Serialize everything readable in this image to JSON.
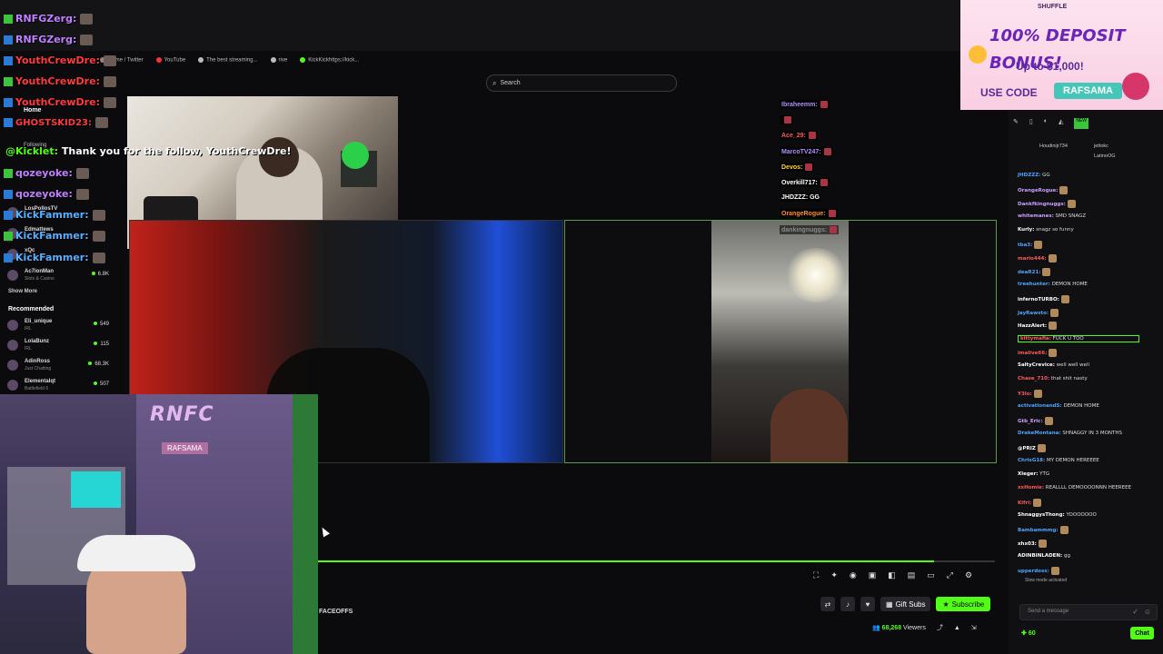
{
  "bookmarks": [
    "Home / Twitter",
    "YouTube",
    "The best streaming...",
    "rive",
    "KickKickhttps://kick..."
  ],
  "search": {
    "placeholder": "Search"
  },
  "nav": {
    "home": "Home",
    "following": "Following",
    "show_more": "Show More",
    "recommended": "Recommended"
  },
  "overlay_chat": [
    {
      "name": "RNFGZerg:",
      "color": "#c080ff"
    },
    {
      "name": "RNFGZerg:",
      "color": "#c080ff"
    },
    {
      "name": "YouthCrewDre:",
      "color": "#ff3b3b"
    },
    {
      "name": "YouthCrewDre:",
      "color": "#ff3b3b"
    },
    {
      "name": "YouthCrewDre:",
      "color": "#ff3b3b"
    },
    {
      "name": "GHOSTSKID23:",
      "color": "#ff3b3b"
    },
    {
      "name": "qozeyoke:",
      "color": "#c080ff"
    },
    {
      "name": "qozeyoke:",
      "color": "#c080ff"
    },
    {
      "name": "KickFammer:",
      "color": "#5ab0ff"
    },
    {
      "name": "KickFammer:",
      "color": "#5ab0ff"
    },
    {
      "name": "KickFammer:",
      "color": "#5ab0ff"
    }
  ],
  "follow_message": {
    "bot": "@Kicklet:",
    "text": "Thank you for the follow, YouthCrewDre!"
  },
  "sidebar": {
    "following": [
      {
        "name": "LosPollosTV",
        "sub": "",
        "count": ""
      },
      {
        "name": "Edmattews",
        "sub": "",
        "count": ""
      },
      {
        "name": "xQc",
        "sub": "",
        "count": ""
      },
      {
        "name": "Ac7ionMan",
        "sub": "Slots & Casino",
        "count": "6.8K"
      }
    ],
    "recommended": [
      {
        "name": "Eli_unique",
        "sub": "IRL",
        "count": "549"
      },
      {
        "name": "LolaBunz",
        "sub": "IRL",
        "count": "115"
      },
      {
        "name": "AdinRoss",
        "sub": "Just Chatting",
        "count": "68.3K"
      },
      {
        "name": "Elementalqt",
        "sub": "Battlefield 6",
        "count": "507"
      }
    ]
  },
  "video_overlay_names": [
    {
      "name": "Ibraheemm:",
      "color": "#b08cff"
    },
    {
      "name": "",
      "color": "#ff3b3b"
    },
    {
      "name": "Ace_29:",
      "color": "#ff5a5a"
    },
    {
      "name": "MarcoTV247:",
      "color": "#b08cff"
    },
    {
      "name": "Devos:",
      "color": "#ffd43b"
    },
    {
      "name": "Overkill717:",
      "color": "#ffffff"
    },
    {
      "name": "JHDZZZ:",
      "color": "#ffffff",
      "text": "GG"
    },
    {
      "name": "OrangeRogue:",
      "color": "#ff8c2a"
    },
    {
      "name": "dankingnuggs:",
      "color": "#8a8a8a"
    }
  ],
  "stream": {
    "title": "FACEOFFS",
    "viewers": "68,268",
    "viewers_label": "Viewers",
    "progress": 0.91
  },
  "buttons": {
    "gift": "Gift Subs",
    "subscribe": "Subscribe",
    "chat": "Chat"
  },
  "chat": {
    "leaders": [
      "Houdinijr734",
      "jettokc",
      "LatinoOG"
    ],
    "messages": [
      {
        "user": "JHDZZZ:",
        "color": "#4fa3ff",
        "text": "GG"
      },
      {
        "user": "OrangeRogue:",
        "color": "#c9a0ff",
        "text": ""
      },
      {
        "user": "Dankfkingnuggs:",
        "color": "#c9a0ff",
        "text": ""
      },
      {
        "user": "whitemanes:",
        "color": "#c9a0ff",
        "text": "SMD SNAGZ"
      },
      {
        "user": "Kurly:",
        "color": "#ffffff",
        "text": "snagz so funny"
      },
      {
        "user": "tba3:",
        "color": "#4fa3ff",
        "text": ""
      },
      {
        "user": "mario444:",
        "color": "#ff5a5a",
        "text": ""
      },
      {
        "user": "deaR21:",
        "color": "#4fa3ff",
        "text": ""
      },
      {
        "user": "treehunter:",
        "color": "#4fa3ff",
        "text": "DEMON HOME"
      },
      {
        "user": "infernoTURBO:",
        "color": "#ffffff",
        "text": ""
      },
      {
        "user": "JayRawsto:",
        "color": "#4fa3ff",
        "text": ""
      },
      {
        "user": "HazzAlert:",
        "color": "#ffffff",
        "text": ""
      },
      {
        "user": "kittymafia:",
        "color": "#ff5a5a",
        "text": "FUCK U TOO"
      },
      {
        "user": "imalive66:",
        "color": "#ff5a5a",
        "text": ""
      },
      {
        "user": "SaltyCrevice:",
        "color": "#ffffff",
        "text": "well well well"
      },
      {
        "user": "Chase_710:",
        "color": "#ff5a5a",
        "text": "that shit nasty"
      },
      {
        "user": "Y3lo:",
        "color": "#ff5a5a",
        "text": ""
      },
      {
        "user": "activationandS:",
        "color": "#4fa3ff",
        "text": "DEMON HOME"
      },
      {
        "user": "Gtb_Eric:",
        "color": "#c9a0ff",
        "text": ""
      },
      {
        "user": "DrakeMontana:",
        "color": "#4fa3ff",
        "text": "SHNAGGY IN 3 MONTHS"
      },
      {
        "user": "@PRIZ",
        "color": "#ffffff",
        "text": ""
      },
      {
        "user": "ChrisG18:",
        "color": "#4fa3ff",
        "text": "MY DEMON HEREEEE"
      },
      {
        "user": "Xleger:",
        "color": "#ffffff",
        "text": "YTG"
      },
      {
        "user": "xxHomie:",
        "color": "#ff5a5a",
        "text": "REALLLL DEMOOOONNN HEEREEE"
      },
      {
        "user": "Kifri:",
        "color": "#ff5a5a",
        "text": ""
      },
      {
        "user": "ShnaggysThong:",
        "color": "#ffffff",
        "text": "YOOOOOOO"
      },
      {
        "user": "Bambammmg:",
        "color": "#4fa3ff",
        "text": ""
      },
      {
        "user": "xhx03:",
        "color": "#ffffff",
        "text": ""
      },
      {
        "user": "ADINBINLADEN:",
        "color": "#ffffff",
        "text": "gg"
      },
      {
        "user": "upperdoss:",
        "color": "#4fa3ff",
        "text": ""
      }
    ],
    "slow_mode": "Slow mode activated",
    "placeholder": "Send a message",
    "points": "60"
  },
  "ad": {
    "brand": "SHUFFLE",
    "headline": "100% DEPOSIT BONUS!",
    "sub": "Up to $1,000!",
    "use_code": "USE CODE",
    "code": "RAFSAMA",
    "new_badge": "NEW"
  },
  "streamer_cam": {
    "logo": "RNFC",
    "tag": "RAFSAMA"
  }
}
